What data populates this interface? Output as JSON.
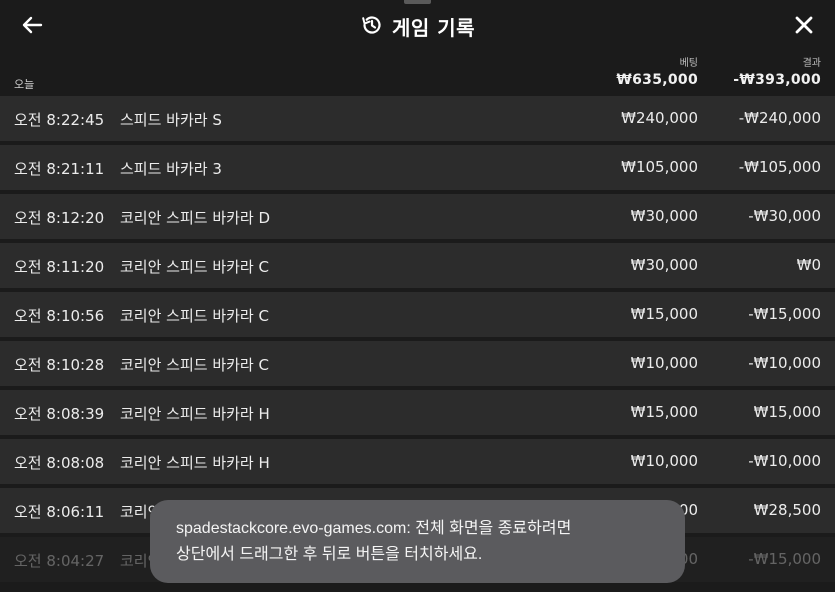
{
  "header": {
    "title": "게임 기록",
    "back_icon": "arrow-left-icon",
    "history_icon": "history-icon",
    "close_icon": "close-icon"
  },
  "summary": {
    "section_label": "오늘",
    "bet_header": "베팅",
    "result_header": "결과",
    "bet_total": "₩635,000",
    "result_total": "-₩393,000"
  },
  "rows": [
    {
      "time": "오전 8:22:45",
      "game": "스피드 바카라 S",
      "bet": "₩240,000",
      "result": "-₩240,000"
    },
    {
      "time": "오전 8:21:11",
      "game": "스피드 바카라 3",
      "bet": "₩105,000",
      "result": "-₩105,000"
    },
    {
      "time": "오전 8:12:20",
      "game": "코리안 스피드 바카라 D",
      "bet": "₩30,000",
      "result": "-₩30,000"
    },
    {
      "time": "오전 8:11:20",
      "game": "코리안 스피드 바카라 C",
      "bet": "₩30,000",
      "result": "₩0"
    },
    {
      "time": "오전 8:10:56",
      "game": "코리안 스피드 바카라 C",
      "bet": "₩15,000",
      "result": "-₩15,000"
    },
    {
      "time": "오전 8:10:28",
      "game": "코리안 스피드 바카라 C",
      "bet": "₩10,000",
      "result": "-₩10,000"
    },
    {
      "time": "오전 8:08:39",
      "game": "코리안 스피드 바카라 H",
      "bet": "₩15,000",
      "result": "₩15,000"
    },
    {
      "time": "오전 8:08:08",
      "game": "코리안 스피드 바카라 H",
      "bet": "₩10,000",
      "result": "-₩10,000"
    },
    {
      "time": "오전 8:06:11",
      "game": "코리안 스피드 바카라 H",
      "bet": "₩10,000",
      "result": "₩28,500"
    },
    {
      "time": "오전 8:04:27",
      "game": "코리안 스피드 바카라 H",
      "bet": "₩15,000",
      "result": "-₩15,000"
    }
  ],
  "toast": {
    "line1": "spadestackcore.evo-games.com: 전체 화면을 종료하려면",
    "line2": "상단에서 드래그한 후 뒤로 버튼을 터치하세요."
  },
  "colors": {
    "background": "#1b1b1b",
    "row": "#2c2c2c",
    "toast": "#5b5b5e",
    "text": "#ececec"
  }
}
